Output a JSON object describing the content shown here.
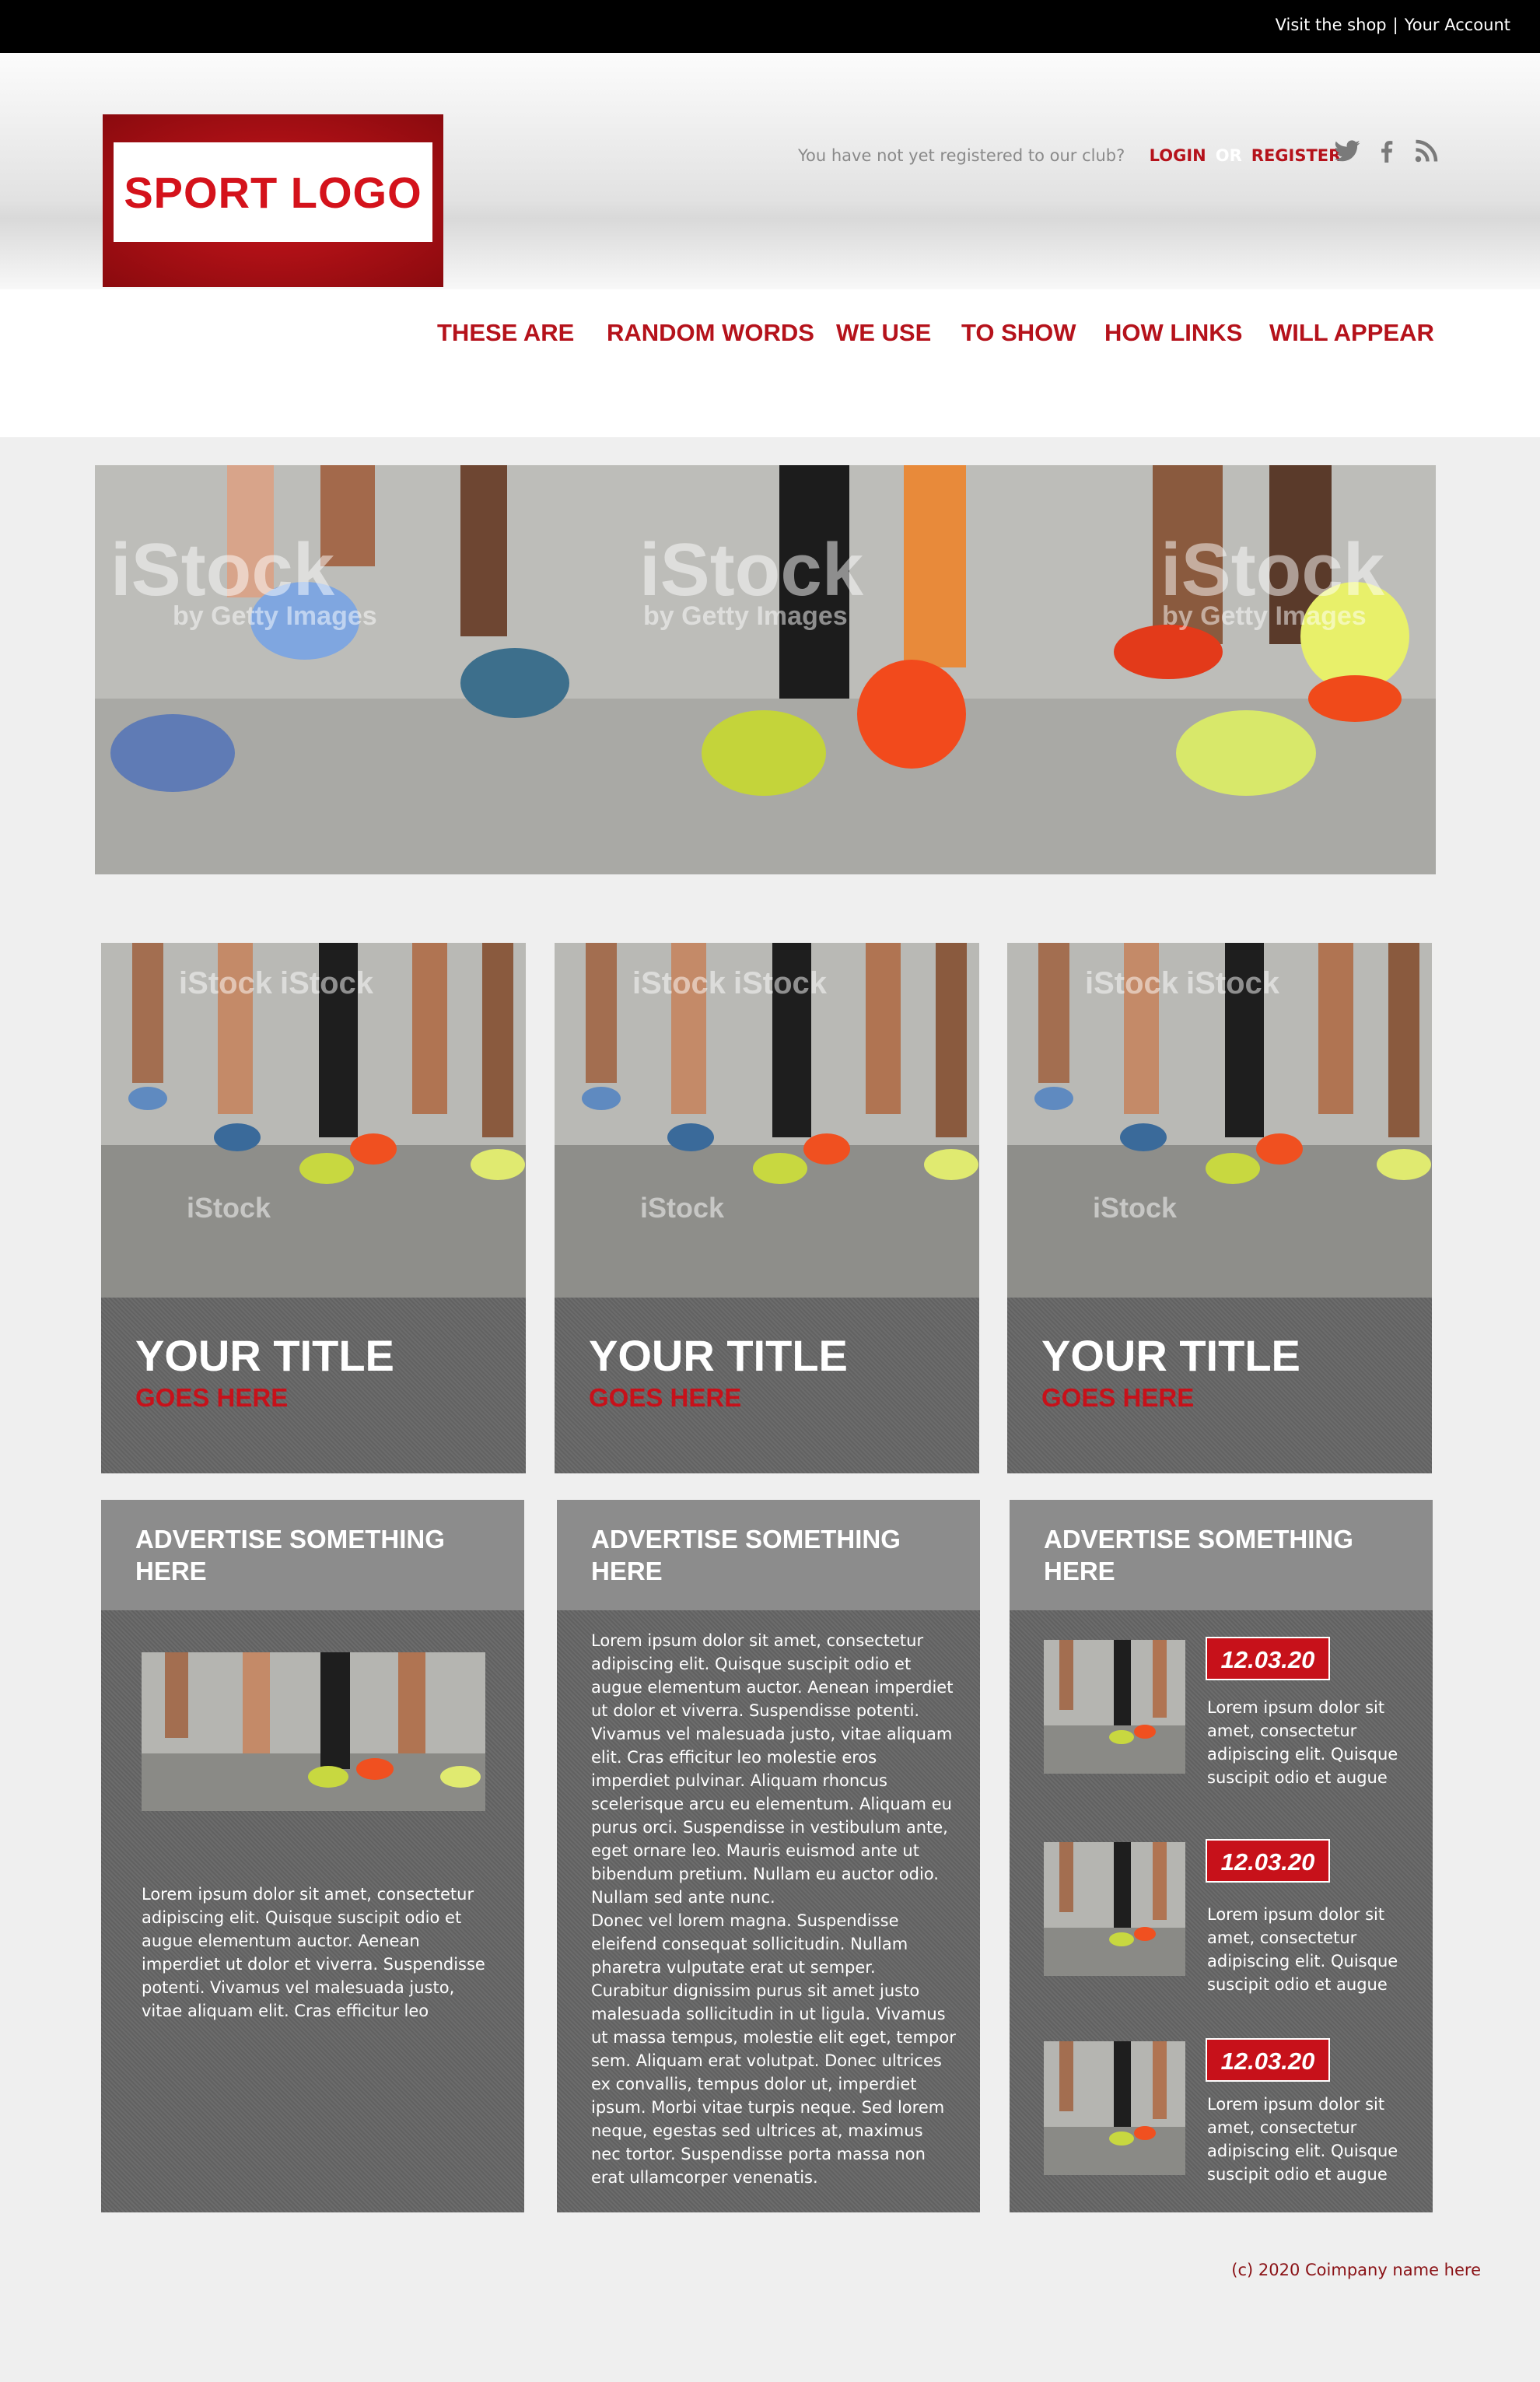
{
  "topbar": {
    "shop_link": "Visit the shop",
    "separator": "|",
    "account_link": "Your Account"
  },
  "header": {
    "logo_text": "SPORT LOGO",
    "register_prompt": "You have not yet registered to our club?",
    "login": "LOGIN",
    "or": "OR",
    "register": "REGISTER",
    "social": [
      "twitter-icon",
      "facebook-icon",
      "rss-icon"
    ]
  },
  "nav": [
    "THESE ARE",
    "RANDOM WORDS",
    "WE USE",
    "TO SHOW",
    "HOW LINKS",
    "WILL APPEAR"
  ],
  "watermark": {
    "brand": "iStock",
    "sub": "by Getty Images"
  },
  "cards": [
    {
      "title": "YOUR TITLE",
      "subtitle": "GOES HERE"
    },
    {
      "title": "YOUR TITLE",
      "subtitle": "GOES HERE"
    },
    {
      "title": "YOUR TITLE",
      "subtitle": "GOES HERE"
    }
  ],
  "ads": [
    {
      "heading": "ADVERTISE SOMETHING HERE",
      "text": "Lorem ipsum dolor sit amet, consectetur adipiscing elit. Quisque suscipit odio et augue elementum auctor. Aenean imperdiet ut dolor et viverra. Suspendisse potenti. Vivamus vel malesuada justo, vitae aliquam elit. Cras efficitur leo"
    },
    {
      "heading": "ADVERTISE SOMETHING HERE",
      "text": "Lorem ipsum dolor sit amet, consectetur adipiscing elit. Quisque suscipit odio et augue elementum auctor. Aenean imperdiet ut dolor et viverra. Suspendisse potenti. Vivamus vel malesuada justo, vitae aliquam elit. Cras efficitur leo molestie eros imperdiet pulvinar. Aliquam rhoncus scelerisque arcu eu elementum. Aliquam eu purus orci. Suspendisse in vestibulum ante, eget ornare leo. Mauris euismod ante ut bibendum pretium. Nullam eu auctor odio. Nullam sed ante nunc.",
      "text2": "Donec vel lorem magna. Suspendisse eleifend consequat sollicitudin. Nullam pharetra vulputate erat ut semper. Curabitur dignissim purus sit amet justo malesuada sollicitudin in ut ligula. Vivamus ut massa tempus, molestie elit eget, tempor sem. Aliquam erat volutpat. Donec ultrices ex convallis, tempus dolor ut, imperdiet ipsum. Morbi vitae turpis neque. Sed lorem neque, egestas sed ultrices at, maximus nec tortor. Suspendisse porta massa non erat ullamcorper venenatis."
    },
    {
      "heading": "ADVERTISE SOMETHING HERE",
      "events": [
        {
          "date": "12.03.20",
          "text": "Lorem ipsum dolor sit amet, consectetur adipiscing elit. Quisque suscipit odio et augue"
        },
        {
          "date": "12.03.20",
          "text": "Lorem ipsum dolor sit amet, consectetur adipiscing elit. Quisque suscipit odio et augue"
        },
        {
          "date": "12.03.20",
          "text": "Lorem ipsum dolor sit amet, consectetur adipiscing elit. Quisque suscipit odio et augue"
        }
      ]
    }
  ],
  "footer": "(c) 2020 Coimpany name here"
}
